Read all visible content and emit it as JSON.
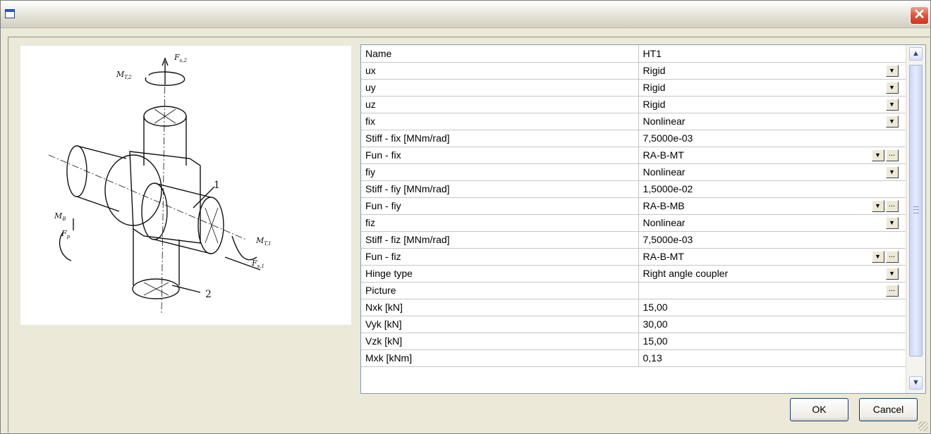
{
  "window": {
    "title": ""
  },
  "properties": [
    {
      "name": "Name",
      "value": "HT1",
      "dropdown": false,
      "ellipsis": false
    },
    {
      "name": "ux",
      "value": "Rigid",
      "dropdown": true,
      "ellipsis": false
    },
    {
      "name": "uy",
      "value": "Rigid",
      "dropdown": true,
      "ellipsis": false
    },
    {
      "name": "uz",
      "value": "Rigid",
      "dropdown": true,
      "ellipsis": false
    },
    {
      "name": "fix",
      "value": "Nonlinear",
      "dropdown": true,
      "ellipsis": false
    },
    {
      "name": "Stiff - fix [MNm/rad]",
      "value": "7,5000e-03",
      "dropdown": false,
      "ellipsis": false
    },
    {
      "name": "Fun -  fix",
      "value": "RA-B-MT",
      "dropdown": true,
      "ellipsis": true
    },
    {
      "name": "fiy",
      "value": "Nonlinear",
      "dropdown": true,
      "ellipsis": false
    },
    {
      "name": "Stiff - fiy [MNm/rad]",
      "value": "1,5000e-02",
      "dropdown": false,
      "ellipsis": false
    },
    {
      "name": "Fun -  fiy",
      "value": "RA-B-MB",
      "dropdown": true,
      "ellipsis": true
    },
    {
      "name": "fiz",
      "value": "Nonlinear",
      "dropdown": true,
      "ellipsis": false
    },
    {
      "name": "Stiff - fiz [MNm/rad]",
      "value": "7,5000e-03",
      "dropdown": false,
      "ellipsis": false
    },
    {
      "name": "Fun -  fiz",
      "value": "RA-B-MT",
      "dropdown": true,
      "ellipsis": true
    },
    {
      "name": "Hinge type",
      "value": "Right angle coupler",
      "dropdown": true,
      "ellipsis": false
    },
    {
      "name": "Picture",
      "value": "",
      "dropdown": false,
      "ellipsis": true
    },
    {
      "name": "Nxk [kN]",
      "value": "15,00",
      "dropdown": false,
      "ellipsis": false
    },
    {
      "name": "Vyk [kN]",
      "value": "30,00",
      "dropdown": false,
      "ellipsis": false
    },
    {
      "name": "Vzk [kN]",
      "value": "15,00",
      "dropdown": false,
      "ellipsis": false
    },
    {
      "name": "Mxk [kNm]",
      "value": "0,13",
      "dropdown": false,
      "ellipsis": false
    }
  ],
  "picture_labels": {
    "fs2": "F",
    "fs2_sub": "s,2",
    "mt2": "M",
    "mt2_sub": "T,2",
    "mb": "M",
    "mb_sub": "B",
    "fp": "F",
    "fp_sub": "p",
    "mt1": "M",
    "mt1_sub": "T,1",
    "fs1": "F",
    "fs1_sub": "s,1",
    "part1": "1",
    "part2": "2"
  },
  "buttons": {
    "ok": "OK",
    "cancel": "Cancel"
  },
  "icons": {
    "close": "close-icon",
    "dropdown": "chevron-down-icon",
    "ellipsis": "ellipsis-icon",
    "scroll_up": "arrow-up-icon",
    "scroll_down": "arrow-down-icon"
  },
  "colors": {
    "close_button": "#e0523a",
    "grid_border": "#7f9db9",
    "scroll_thumb": "#ccd6f8"
  }
}
